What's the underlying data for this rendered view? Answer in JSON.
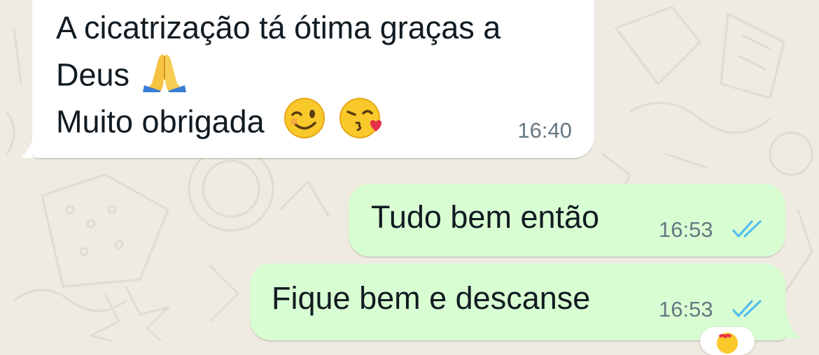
{
  "colors": {
    "wallpaper": "#efeae2",
    "incoming_bubble": "#ffffff",
    "outgoing_bubble": "#d9fdd3",
    "read_ticks": "#53bdeb",
    "text": "#111b21",
    "timestamp": "#667781"
  },
  "messages": [
    {
      "direction": "incoming",
      "lines": [
        "A cicatrização tá ótima graças a",
        "Deus",
        "Muito obrigada"
      ],
      "emojis": [
        "folded-hands",
        "winking-face",
        "face-blowing-kiss"
      ],
      "time": "16:40"
    },
    {
      "direction": "outgoing",
      "text": "Tudo bem então",
      "time": "16:53",
      "status": "read"
    },
    {
      "direction": "outgoing",
      "text": "Fique bem e descanse",
      "time": "16:53",
      "status": "read"
    }
  ]
}
